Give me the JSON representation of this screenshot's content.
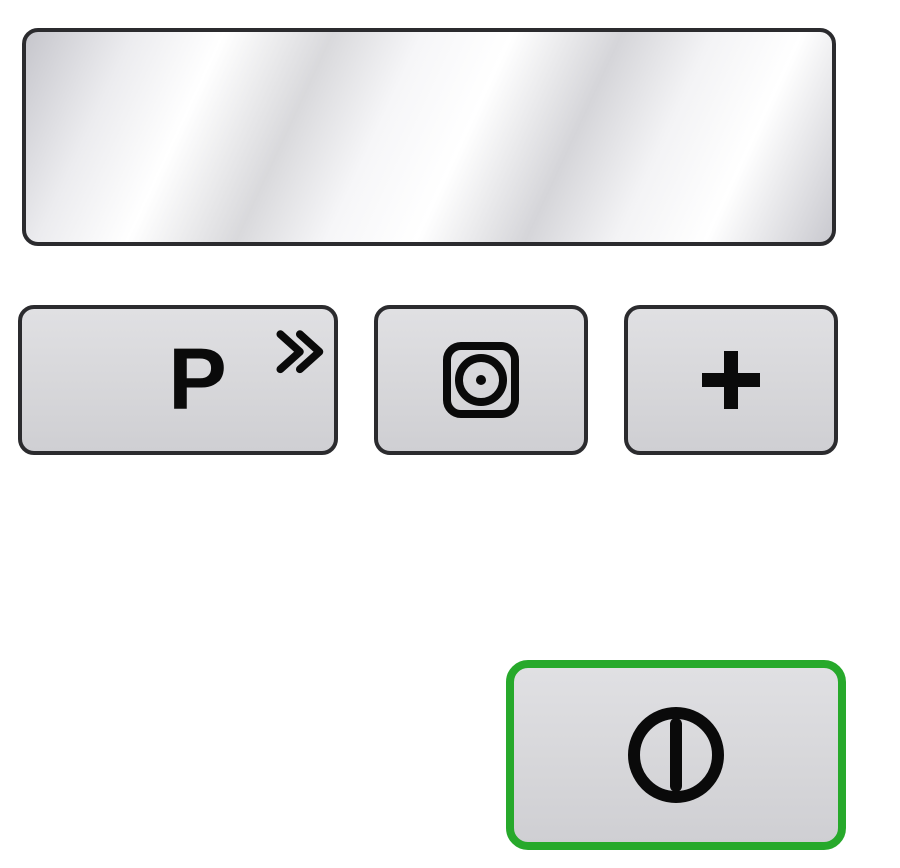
{
  "display": {
    "content": ""
  },
  "buttons": {
    "program": {
      "label": "P",
      "overlay_icon": "chevrons-right-icon"
    },
    "dryer": {
      "icon": "tumble-dryer-icon"
    },
    "add": {
      "icon": "plus-icon",
      "label": "+"
    },
    "start": {
      "icon": "power-start-icon",
      "accent_color": "#27a92b"
    }
  },
  "colors": {
    "button_face": "#d8d8db",
    "button_border": "#2b2b2e",
    "start_border": "#27a92b"
  }
}
